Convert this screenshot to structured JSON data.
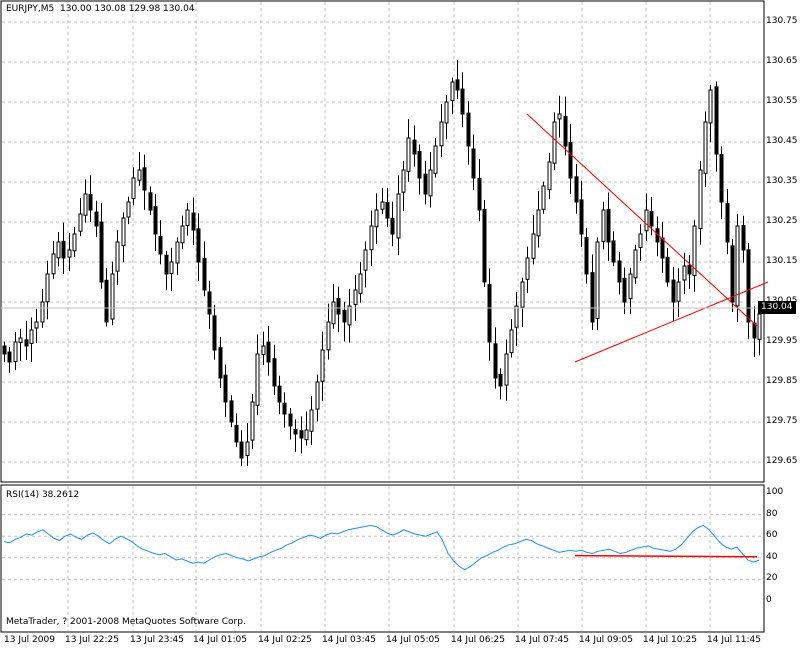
{
  "header": {
    "symbol": "EURJPY,M5",
    "ohlc": "130.00 130.08 129.98 130.04"
  },
  "rsi": {
    "label": "RSI(14) 38.2612",
    "ticks": [
      "100",
      "80",
      "60",
      "40",
      "20",
      "0"
    ]
  },
  "copyright": "MetaTrader, ? 2001-2008 MetaQuotes Software Corp.",
  "current_price": "130.04",
  "colors": {
    "background": "#ffffff",
    "grid": "#c0c0c0",
    "candle": "#000000",
    "trendline": "#ff0000",
    "rsi_line": "#1e90ff"
  },
  "chart_data": [
    {
      "type": "candlestick",
      "title": "EURJPY,M5",
      "y_ticks": [
        "130.75",
        "130.65",
        "130.55",
        "130.45",
        "130.35",
        "130.25",
        "130.15",
        "130.05",
        "129.95",
        "129.85",
        "129.75",
        "129.65"
      ],
      "ylim": [
        129.61,
        130.79
      ],
      "x_ticks": [
        "13 Jul 2009",
        "13 Jul 22:25",
        "13 Jul 23:45",
        "14 Jul 01:05",
        "14 Jul 02:25",
        "14 Jul 03:45",
        "14 Jul 05:05",
        "14 Jul 06:25",
        "14 Jul 07:45",
        "14 Jul 09:05",
        "14 Jul 10:25",
        "14 Jul 11:45"
      ],
      "grid": true,
      "close": [
        129.92,
        129.9,
        129.95,
        129.96,
        129.94,
        129.98,
        130.0,
        130.05,
        130.12,
        130.17,
        130.2,
        130.16,
        130.18,
        130.22,
        130.27,
        130.32,
        130.28,
        130.24,
        130.1,
        130.0,
        130.12,
        130.2,
        130.26,
        130.3,
        130.36,
        130.38,
        130.33,
        130.28,
        130.22,
        130.17,
        130.12,
        130.15,
        130.2,
        130.24,
        130.28,
        130.23,
        130.15,
        130.08,
        130.02,
        129.93,
        129.86,
        129.8,
        129.75,
        129.7,
        129.66,
        129.7,
        129.8,
        129.92,
        129.94,
        129.9,
        129.84,
        129.8,
        129.77,
        129.74,
        129.72,
        129.71,
        129.73,
        129.78,
        129.85,
        129.93,
        130.0,
        130.05,
        130.02,
        130.0,
        130.04,
        130.08,
        130.12,
        130.18,
        130.24,
        130.28,
        130.3,
        130.26,
        130.22,
        130.32,
        130.38,
        130.46,
        130.42,
        130.36,
        130.32,
        130.38,
        130.44,
        130.5,
        130.55,
        130.6,
        130.58,
        130.52,
        130.44,
        130.36,
        130.28,
        130.1,
        129.95,
        129.86,
        129.84,
        129.92,
        129.98,
        130.04,
        130.1,
        130.16,
        130.22,
        130.28,
        130.34,
        130.4,
        130.5,
        130.52,
        130.44,
        130.36,
        130.3,
        130.22,
        130.12,
        130.0,
        130.2,
        130.28,
        130.2,
        130.15,
        130.1,
        130.05,
        130.12,
        130.18,
        130.22,
        130.28,
        130.24,
        130.2,
        130.16,
        130.1,
        130.05,
        130.1,
        130.14,
        130.12,
        130.24,
        130.38,
        130.5,
        130.58,
        130.42,
        130.3,
        130.2,
        130.05,
        130.24,
        130.18,
        130.0,
        129.96,
        130.02
      ]
    },
    {
      "type": "line",
      "title": "RSI(14) 38.2612",
      "ylim": [
        0,
        100
      ],
      "y_ticks": [
        "100",
        "80",
        "60",
        "40",
        "20",
        "0"
      ],
      "levels": [
        40,
        60
      ],
      "values": [
        55,
        54,
        57,
        59,
        62,
        61,
        64,
        66,
        62,
        58,
        56,
        60,
        62,
        59,
        57,
        61,
        63,
        60,
        56,
        53,
        57,
        60,
        58,
        55,
        51,
        48,
        46,
        44,
        43,
        44,
        41,
        38,
        39,
        37,
        35,
        36,
        35,
        38,
        41,
        43,
        44,
        42,
        40,
        39,
        37,
        39,
        41,
        42,
        45,
        47,
        49,
        52,
        54,
        57,
        59,
        61,
        60,
        58,
        61,
        63,
        62,
        64,
        66,
        67,
        68,
        69,
        70,
        69,
        66,
        63,
        61,
        63,
        66,
        64,
        62,
        61,
        60,
        62,
        64,
        56,
        44,
        37,
        32,
        29,
        32,
        36,
        40,
        42,
        45,
        47,
        50,
        52,
        53,
        55,
        57,
        56,
        53,
        51,
        49,
        47,
        45,
        46,
        47,
        46,
        47,
        45,
        44,
        46,
        47,
        48,
        46,
        44,
        45,
        47,
        49,
        50,
        51,
        49,
        48,
        47,
        46,
        48,
        52,
        58,
        64,
        68,
        70,
        66,
        60,
        54,
        50,
        48,
        50,
        44,
        38,
        36,
        38
      ]
    },
    {
      "type": "line",
      "role": "trendlines",
      "lines": [
        {
          "pane": "price",
          "from": [
            527,
            130.52
          ],
          "to": [
            757,
            129.99
          ]
        },
        {
          "pane": "price",
          "from": [
            575,
            129.9
          ],
          "to": [
            768,
            130.1
          ]
        },
        {
          "pane": "rsi",
          "from": [
            575,
            42
          ],
          "to": [
            757,
            41
          ]
        }
      ]
    }
  ]
}
